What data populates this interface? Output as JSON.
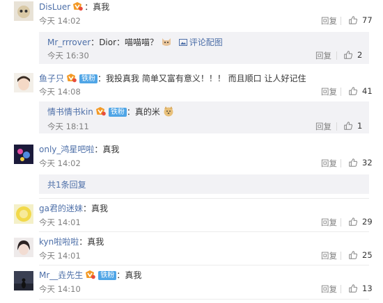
{
  "labels": {
    "reply": "回复",
    "like_icon": "thumbs-up-icon"
  },
  "comments": [
    {
      "user": "DisLuer",
      "text": "真我",
      "time": "今天 14:02",
      "likes": "77",
      "vip": true,
      "fan_badge": ""
    },
    {
      "user": "鱼子只",
      "text": "我投真我 简单又富有意义！！！ 而且顺口 让人好记住",
      "time": "今天 14:08",
      "likes": "41",
      "vip": true,
      "fan_badge": "铁粉"
    },
    {
      "user": "only_鸿星吧啦",
      "text": "真我",
      "time": "今天 14:02",
      "likes": "32"
    },
    {
      "user": "ga君的迷妹",
      "text": "真我",
      "time": "今天 14:01",
      "likes": "29"
    },
    {
      "user": "kyn啦啦啦",
      "text": "真我",
      "time": "今天 14:01",
      "likes": "25"
    },
    {
      "user": "Mr__垚先生",
      "text": "真我",
      "time": "今天 14:10",
      "likes": "13",
      "vip": true,
      "fan_badge": "铁粉"
    }
  ],
  "replies": [
    {
      "user": "Mr_rrrover",
      "text": "Dior：喵喵喵？",
      "pic_link": "评论配图",
      "time": "今天 16:30",
      "likes": "2"
    },
    {
      "user": "情书情书kin",
      "text": "真的米",
      "time": "今天 18:11",
      "likes": "1",
      "vip": true,
      "fan_badge": "铁粉"
    }
  ],
  "more_replies": "共1条回复",
  "colors": {
    "link": "#4d6fa8",
    "fan_badge": "#4fa5e6",
    "vip": "#f39a26",
    "subbg": "#f2f2f5"
  }
}
